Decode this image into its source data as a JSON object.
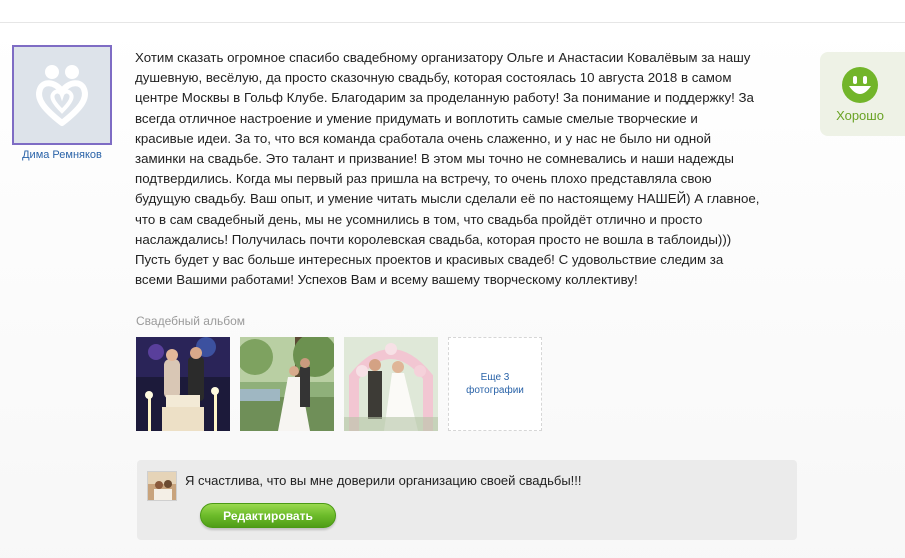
{
  "author": {
    "name": "Дима Ремняков",
    "avatar_icon": "couple-heart-logo-icon"
  },
  "review": {
    "text": "Хотим сказать огромное спасибо свадебному организатору Ольге и Анастасии Ковалёвым за нашу\nдушевную, весёлую, да просто сказочную свадьбу, которая состоялась 10 августа 2018 в самом\nцентре Москвы в Гольф Клубе. Благодарим за проделанную работу! За понимание и поддержку! За\nвсегда отличное настроение и умение придумать и воплотить самые смелые творческие и\nкрасивые идеи. За то, что вся команда сработала очень слаженно, и у нас не было ни одной\nзаминки на свадьбе. Это талант и призвание! В этом мы точно не сомневались и наши надежды\nподтвердились. Когда мы первый раз пришла на встречу, то очень плохо представляла свою\nбудущую свадьбу. Ваш опыт, и умение читать мысли сделали её по настоящему НАШЕЙ) А главное,\nчто в сам свадебный день, мы не усомнились в том, что свадьба пройдёт отлично и просто\nнаслаждались! Получилась почти королевская свадьба, которая просто не вошла в таблоиды)))\nПусть будет у вас больше интересных проектов и красивых свадеб! С удовольствие следим за\nвсеми Вашими работами! Успехов Вам и всему вашему творческому коллективу!"
  },
  "rating": {
    "label": "Хорошо",
    "icon": "smiley-face-icon",
    "color": "#6aa325"
  },
  "album": {
    "title": "Свадебный альбом",
    "photos": [
      {
        "name": "photo-wedding-cake"
      },
      {
        "name": "photo-couple-park"
      },
      {
        "name": "photo-couple-flower-arch"
      }
    ],
    "more_label": "Еще 3 фотографии"
  },
  "reply": {
    "text": "Я счастлива, что вы мне доверили организацию своей свадьбы!!!",
    "edit_label": "Редактировать"
  }
}
